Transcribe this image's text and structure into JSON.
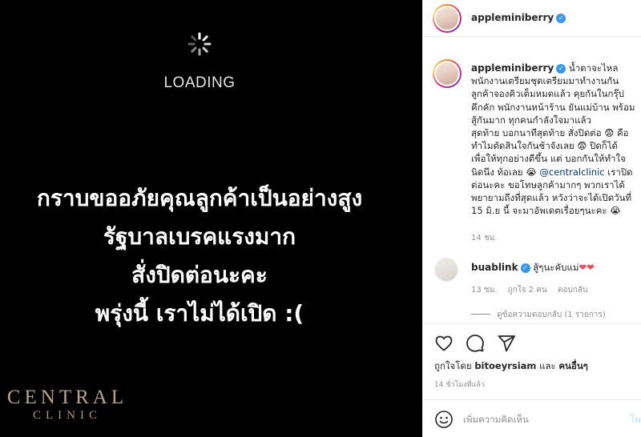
{
  "media": {
    "loading_text": "LOADING",
    "apology_lines": [
      "กราบขออภัยคุณลูกค้าเป็นอย่างสูง",
      "รัฐบาลเบรคแรงมาก",
      "สั่งปิดต่อนะคะ",
      "พรุ่งนี้ เราไม่ได้เปิด :("
    ],
    "logo_line1": "CENTRAL",
    "logo_line2": "CLINIC"
  },
  "header": {
    "username": "appleminiberry",
    "verified_icon": "verified-badge-icon"
  },
  "caption": {
    "username": "appleminiberry",
    "verified_icon": "verified-badge-icon",
    "text_before_mention": "น้ำตาจะไหล\nพนักงานเตรียมชุดเตรียมมาทำงานกัน\nลูกค้าจองคิวเต็มหมดแล้ว คุยกันในกรุ๊ป\nคึกคัก พนักงานหน้าร้าน ยันแม่บ้าน พร้อม\nสู้กันมาก ทุกคนกำลังใจมาแล้ว\nสุดท้าย บอกนาทีสุดท้าย สั่งปิดต่อ 😨 คือ\nทำไมตัดสินใจกันช้าจังเลย 😨 ปิดก็ได้\nเพื่อให้ทุกอย่างดีขึ้น แต่ บอกกันให้ทำใจ\nนิดนึง ท้อเลย 😭 ",
    "mention": "@centralclinic",
    "text_after_mention": " เราปิด\nต่อนะคะ ขอโทษลูกค้ามากๆ พวกเราได้\nพยายามถึงที่สุดแล้ว หวังว่าจะได้เปิดวันที่\n15 มิ.ย นี้ จะมาอัพเดตเรื่อยๆนะคะ 😭",
    "time": "14 ชม."
  },
  "comment": {
    "username": "buablink",
    "verified_icon": "verified-badge-icon",
    "text": "สู้ๆนะคับแม่",
    "hearts": "❤❤",
    "time": "13 ชม.",
    "likes": "ถูกใจ 2 คน",
    "reply_label": "ตอบกลับ",
    "view_replies": "ดูข้อความตอบกลับ (1 รายการ)"
  },
  "actions": {
    "icons": [
      "heart-icon",
      "comment-icon",
      "share-icon"
    ],
    "liked_by_prefix": "ถูกใจโดย",
    "liked_by_user": "bitoeyrsiam",
    "liked_by_and": "และ",
    "liked_by_others": "คนอื่นๆ",
    "time_ago": "14 ชั่วโมงที่แล้ว"
  },
  "add_comment": {
    "emoji_icon": "smiley-icon",
    "placeholder": "เพิ่มความคิดเห็น",
    "post_label": "โพสต์"
  },
  "colors": {
    "verified": "#3897f0",
    "link": "#00376b",
    "heart": "#ed4956",
    "muted": "#8e8e8e"
  }
}
